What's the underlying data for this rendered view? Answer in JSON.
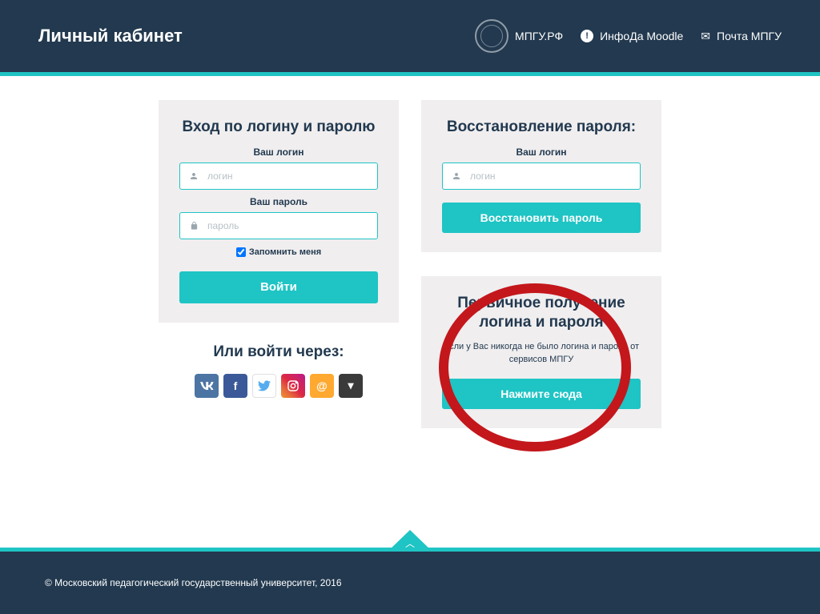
{
  "header": {
    "title": "Личный кабинет",
    "nav": {
      "site": "МПГУ.РФ",
      "moodle": "ИнфоДа Moodle",
      "mail": "Почта МПГУ"
    }
  },
  "login": {
    "title": "Вход по логину и паролю",
    "login_label": "Ваш логин",
    "login_placeholder": "логин",
    "password_label": "Ваш пароль",
    "password_placeholder": "пароль",
    "remember_label": "Запомнить меня",
    "submit": "Войти"
  },
  "social": {
    "title": "Или войти через:"
  },
  "recover": {
    "title": "Восстановление пароля:",
    "login_label": "Ваш логин",
    "login_placeholder": "логин",
    "submit": "Восстановить пароль"
  },
  "obtain": {
    "title": "Первичное получение логина и пароля",
    "subtext": "Если у Вас никогда не было логина и пароля от сервисов МПГУ",
    "submit": "Нажмите сюда"
  },
  "footer": {
    "copyright": "© Московский педагогический государственный университет, 2016"
  }
}
